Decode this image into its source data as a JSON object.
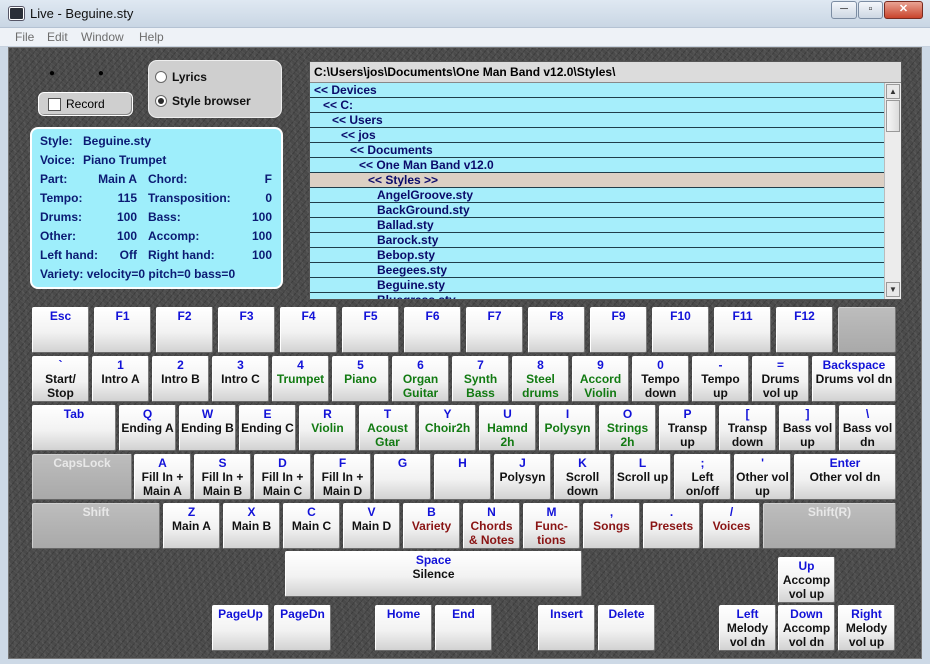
{
  "window": {
    "title": "Live - Beguine.sty",
    "minimize": "─",
    "maximize": "▫",
    "close": "✕"
  },
  "menu": [
    "File",
    "Edit",
    "Window",
    "Help"
  ],
  "indicators": "● ● ● ●",
  "record": {
    "label": "Record",
    "checked": false
  },
  "modes": {
    "lyrics": "Lyrics",
    "style_browser": "Style browser",
    "selected": "style_browser"
  },
  "info": {
    "style_label": "Style:",
    "style": "Beguine.sty",
    "voice_label": "Voice:",
    "voice": "Piano Trumpet",
    "part_label": "Part:",
    "part": "Main A",
    "chord_label": "Chord:",
    "chord": "F",
    "tempo_label": "Tempo:",
    "tempo": "115",
    "transposition_label": "Transposition:",
    "transposition": "0",
    "drums_label": "Drums:",
    "drums": "100",
    "bass_label": "Bass:",
    "bass": "100",
    "other_label": "Other:",
    "other": "100",
    "accomp_label": "Accomp:",
    "accomp": "100",
    "lefthand_label": "Left hand:",
    "lefthand": "Off",
    "righthand_label": "Right hand:",
    "righthand": "100",
    "variety": "Variety: velocity=0 pitch=0 bass=0"
  },
  "browser": {
    "path": "C:\\Users\\jos\\Documents\\One Man Band v12.0\\Styles\\",
    "selected_index": 6,
    "items": [
      {
        "label": "<< Devices",
        "level": 0
      },
      {
        "label": "<< C:",
        "level": 1
      },
      {
        "label": "<< Users",
        "level": 2
      },
      {
        "label": "<< jos",
        "level": 3
      },
      {
        "label": "<< Documents",
        "level": 4
      },
      {
        "label": "<< One Man Band v12.0",
        "level": 5
      },
      {
        "label": "<< Styles >>",
        "level": 6
      },
      {
        "label": "AngelGroove.sty",
        "level": 7
      },
      {
        "label": "BackGround.sty",
        "level": 7
      },
      {
        "label": "Ballad.sty",
        "level": 7
      },
      {
        "label": "Barock.sty",
        "level": 7
      },
      {
        "label": "Bebop.sty",
        "level": 7
      },
      {
        "label": "Beegees.sty",
        "level": 7
      },
      {
        "label": "Beguine.sty",
        "level": 7
      },
      {
        "label": "Bluegrass.sty",
        "level": 7
      }
    ],
    "scroll_up": "▲",
    "scroll_down": "▼"
  },
  "colors": {
    "panel": "#9eeefb",
    "key_label": "#1212d8",
    "func_black": "#111111",
    "func_green": "#127a12",
    "func_red": "#8a1414"
  },
  "keys": [
    {
      "id": "esc",
      "key": "Esc",
      "func": "",
      "color": "black"
    },
    {
      "id": "f1",
      "key": "F1",
      "func": "",
      "color": "black"
    },
    {
      "id": "f2",
      "key": "F2",
      "func": "",
      "color": "black"
    },
    {
      "id": "f3",
      "key": "F3",
      "func": "",
      "color": "black"
    },
    {
      "id": "f4",
      "key": "F4",
      "func": "",
      "color": "black"
    },
    {
      "id": "f5",
      "key": "F5",
      "func": "",
      "color": "black"
    },
    {
      "id": "f6",
      "key": "F6",
      "func": "",
      "color": "black"
    },
    {
      "id": "f7",
      "key": "F7",
      "func": "",
      "color": "black"
    },
    {
      "id": "f8",
      "key": "F8",
      "func": "",
      "color": "black"
    },
    {
      "id": "f9",
      "key": "F9",
      "func": "",
      "color": "black"
    },
    {
      "id": "f10",
      "key": "F10",
      "func": "",
      "color": "black"
    },
    {
      "id": "f11",
      "key": "F11",
      "func": "",
      "color": "black"
    },
    {
      "id": "f12",
      "key": "F12",
      "func": "",
      "color": "black"
    },
    {
      "id": "blank",
      "key": "",
      "func": "",
      "color": "black",
      "disabled": true
    },
    {
      "id": "backtick",
      "key": "`",
      "func": "Start/\nStop",
      "color": "black"
    },
    {
      "id": "1",
      "key": "1",
      "func": "Intro A",
      "color": "black"
    },
    {
      "id": "2",
      "key": "2",
      "func": "Intro B",
      "color": "black"
    },
    {
      "id": "3",
      "key": "3",
      "func": "Intro C",
      "color": "black"
    },
    {
      "id": "4",
      "key": "4",
      "func": "Trumpet",
      "color": "green"
    },
    {
      "id": "5",
      "key": "5",
      "func": "Piano",
      "color": "green"
    },
    {
      "id": "6",
      "key": "6",
      "func": "Organ\nGuitar",
      "color": "green"
    },
    {
      "id": "7",
      "key": "7",
      "func": "Synth\nBass",
      "color": "green"
    },
    {
      "id": "8",
      "key": "8",
      "func": "Steel\ndrums",
      "color": "green"
    },
    {
      "id": "9",
      "key": "9",
      "func": "Accord\nViolin",
      "color": "green"
    },
    {
      "id": "0",
      "key": "0",
      "func": "Tempo\ndown",
      "color": "black"
    },
    {
      "id": "minus",
      "key": "-",
      "func": "Tempo\nup",
      "color": "black"
    },
    {
      "id": "equals",
      "key": "=",
      "func": "Drums\nvol up",
      "color": "black"
    },
    {
      "id": "backspace",
      "key": "Backspace",
      "func": "Drums vol dn",
      "color": "black"
    },
    {
      "id": "tab",
      "key": "Tab",
      "func": "",
      "color": "black"
    },
    {
      "id": "q",
      "key": "Q",
      "func": "Ending A",
      "color": "black"
    },
    {
      "id": "w",
      "key": "W",
      "func": "Ending B",
      "color": "black"
    },
    {
      "id": "e",
      "key": "E",
      "func": "Ending C",
      "color": "black"
    },
    {
      "id": "r",
      "key": "R",
      "func": "Violin",
      "color": "green"
    },
    {
      "id": "t",
      "key": "T",
      "func": "Acoust\nGtar",
      "color": "green"
    },
    {
      "id": "y",
      "key": "Y",
      "func": "Choir2h",
      "color": "green"
    },
    {
      "id": "u",
      "key": "U",
      "func": "Hamnd\n2h",
      "color": "green"
    },
    {
      "id": "i",
      "key": "I",
      "func": "Polysyn",
      "color": "green"
    },
    {
      "id": "o",
      "key": "O",
      "func": "Strings\n2h",
      "color": "green"
    },
    {
      "id": "p",
      "key": "P",
      "func": "Transp\nup",
      "color": "black"
    },
    {
      "id": "lbracket",
      "key": "[",
      "func": "Transp\ndown",
      "color": "black"
    },
    {
      "id": "rbracket",
      "key": "]",
      "func": "Bass vol\nup",
      "color": "black"
    },
    {
      "id": "backslash",
      "key": "\\",
      "func": "Bass vol\ndn",
      "color": "black"
    },
    {
      "id": "capslock",
      "key": "CapsLock",
      "func": "",
      "color": "black",
      "disabled": true
    },
    {
      "id": "a",
      "key": "A",
      "func": "Fill In +\nMain A",
      "color": "black"
    },
    {
      "id": "s",
      "key": "S",
      "func": "Fill In +\nMain B",
      "color": "black"
    },
    {
      "id": "d",
      "key": "D",
      "func": "Fill In +\nMain C",
      "color": "black"
    },
    {
      "id": "f",
      "key": "F",
      "func": "Fill In +\nMain D",
      "color": "black"
    },
    {
      "id": "g",
      "key": "G",
      "func": "",
      "color": "black"
    },
    {
      "id": "h",
      "key": "H",
      "func": "",
      "color": "black"
    },
    {
      "id": "j",
      "key": "J",
      "func": "Polysyn",
      "color": "black"
    },
    {
      "id": "k",
      "key": "K",
      "func": "Scroll\ndown",
      "color": "black"
    },
    {
      "id": "l",
      "key": "L",
      "func": "Scroll up",
      "color": "black"
    },
    {
      "id": "semicolon",
      "key": ";",
      "func": "Left\non/off",
      "color": "black"
    },
    {
      "id": "quote",
      "key": "'",
      "func": "Other vol\nup",
      "color": "black"
    },
    {
      "id": "enter",
      "key": "Enter",
      "func": "Other vol dn",
      "color": "black"
    },
    {
      "id": "shift",
      "key": "Shift",
      "func": "",
      "color": "black",
      "disabled": true
    },
    {
      "id": "z",
      "key": "Z",
      "func": "Main A",
      "color": "black"
    },
    {
      "id": "x",
      "key": "X",
      "func": "Main B",
      "color": "black"
    },
    {
      "id": "c",
      "key": "C",
      "func": "Main C",
      "color": "black"
    },
    {
      "id": "v",
      "key": "V",
      "func": "Main D",
      "color": "black"
    },
    {
      "id": "b",
      "key": "B",
      "func": "Variety",
      "color": "red"
    },
    {
      "id": "n",
      "key": "N",
      "func": "Chords\n& Notes",
      "color": "red"
    },
    {
      "id": "m",
      "key": "M",
      "func": "Func-\ntions",
      "color": "red"
    },
    {
      "id": "comma",
      "key": ",",
      "func": "Songs",
      "color": "red"
    },
    {
      "id": "period",
      "key": ".",
      "func": "Presets",
      "color": "red"
    },
    {
      "id": "slash",
      "key": "/",
      "func": "Voices",
      "color": "red"
    },
    {
      "id": "shiftr",
      "key": "Shift(R)",
      "func": "",
      "color": "black",
      "disabled": true
    },
    {
      "id": "space",
      "key": "Space",
      "func": "Silence",
      "color": "black"
    },
    {
      "id": "up",
      "key": "Up",
      "func": "Accomp\nvol up",
      "color": "black"
    },
    {
      "id": "pageup",
      "key": "PageUp",
      "func": "",
      "color": "black"
    },
    {
      "id": "pagedn",
      "key": "PageDn",
      "func": "",
      "color": "black"
    },
    {
      "id": "home",
      "key": "Home",
      "func": "",
      "color": "black"
    },
    {
      "id": "end",
      "key": "End",
      "func": "",
      "color": "black"
    },
    {
      "id": "insert",
      "key": "Insert",
      "func": "",
      "color": "black"
    },
    {
      "id": "delete",
      "key": "Delete",
      "func": "",
      "color": "black"
    },
    {
      "id": "left",
      "key": "Left",
      "func": "Melody\nvol dn",
      "color": "black"
    },
    {
      "id": "down",
      "key": "Down",
      "func": "Accomp\nvol dn",
      "color": "black"
    },
    {
      "id": "right",
      "key": "Right",
      "func": "Melody\nvol up",
      "color": "black"
    }
  ]
}
